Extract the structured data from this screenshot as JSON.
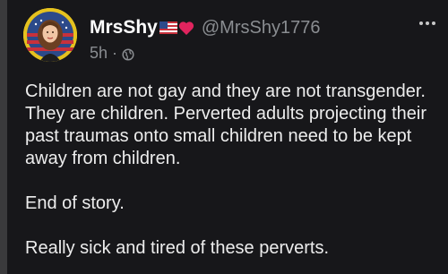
{
  "post": {
    "display_name": "MrsShy",
    "name_emojis": [
      "us-flag-emoji",
      "red-heart-emoji"
    ],
    "handle": "@MrsShy1776",
    "time": "5h",
    "separator": "·",
    "audience_icon": "globe-icon",
    "more_icon": "ellipsis-icon",
    "paragraphs": [
      "Children are not gay and they are not transgender. They are children. Perverted adults projecting their past traumas onto small children need to be kept away from children.",
      "End of story.",
      "Really sick and tired of these perverts."
    ]
  },
  "colors": {
    "background": "#17171a",
    "text": "#ededed",
    "secondary_text": "#8a8d91",
    "avatar_ring": "#e5c21f"
  }
}
